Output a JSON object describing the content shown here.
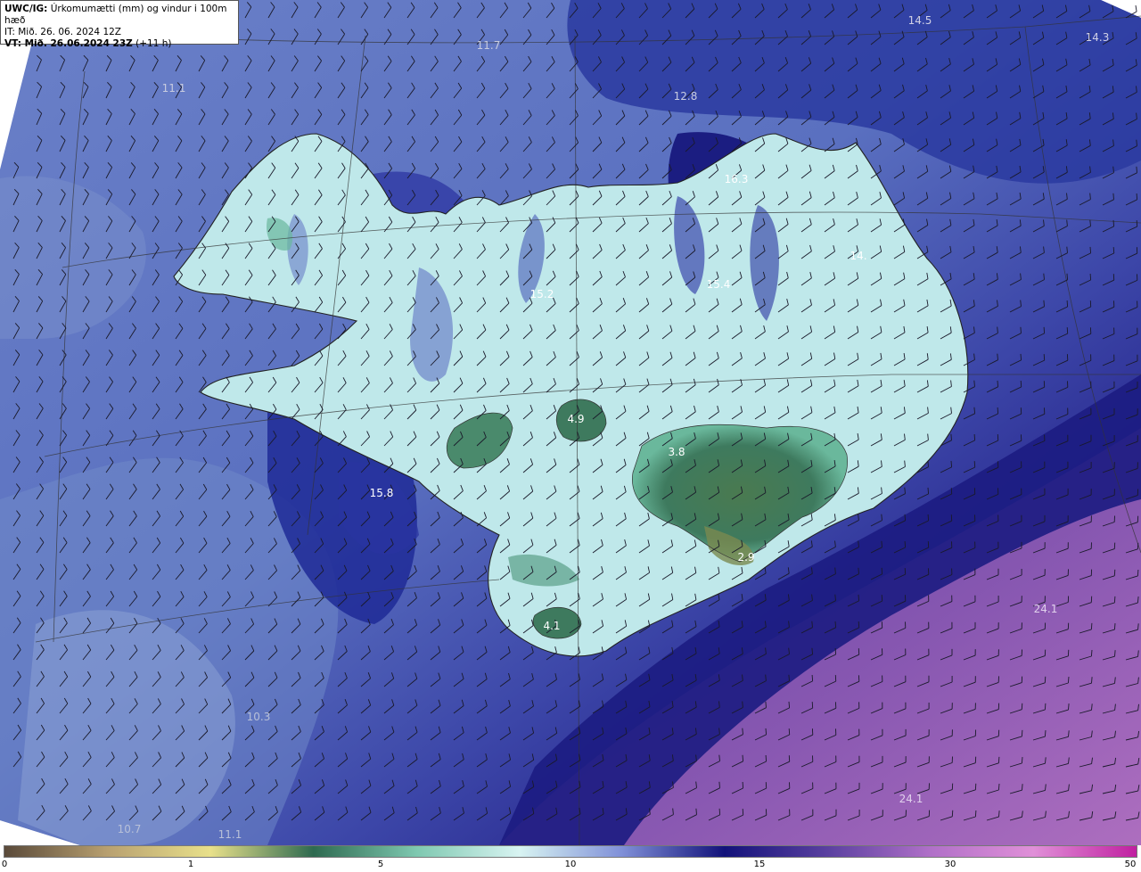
{
  "info_box": {
    "title_bold": "UWC/IG:",
    "title_rest": "Úrkomumætti (mm) og vindur i 100m hæð",
    "line_it": "IT: Mið. 26. 06. 2024 12Z",
    "line_vt_bold": "VT: Mið. 26.06.2024 23Z",
    "line_vt_rest": "(+11 h)"
  },
  "value_labels": [
    {
      "id": "v1",
      "text": "14.5",
      "color": "#d0d0e6"
    },
    {
      "id": "v2",
      "text": "14.3",
      "color": "#d0d0e6"
    },
    {
      "id": "v3",
      "text": "11.7",
      "color": "#c8cce0"
    },
    {
      "id": "v4",
      "text": "11.1",
      "color": "#c8cce0"
    },
    {
      "id": "v5",
      "text": "12.8",
      "color": "#c8cce0"
    },
    {
      "id": "v6",
      "text": "16.3",
      "color": "#ffffff"
    },
    {
      "id": "v7",
      "text": "14.",
      "color": "#ffffff"
    },
    {
      "id": "v8",
      "text": "15.4",
      "color": "#ffffff"
    },
    {
      "id": "v9",
      "text": "15.2",
      "color": "#ffffff"
    },
    {
      "id": "v10",
      "text": "4.9",
      "color": "#ffffff"
    },
    {
      "id": "v11",
      "text": "3.8",
      "color": "#ffffff"
    },
    {
      "id": "v12",
      "text": "15.8",
      "color": "#ffffff"
    },
    {
      "id": "v13",
      "text": "2.9",
      "color": "#ffffff"
    },
    {
      "id": "v14",
      "text": "4.1",
      "color": "#ffffff"
    },
    {
      "id": "v15",
      "text": "24.1",
      "color": "#e0d0ec"
    },
    {
      "id": "v16",
      "text": "24.1",
      "color": "#e0d0ec"
    },
    {
      "id": "v17",
      "text": "10.3",
      "color": "#b8c0d8"
    },
    {
      "id": "v18",
      "text": "10.7",
      "color": "#b8c0d8"
    },
    {
      "id": "v19",
      "text": "11.1",
      "color": "#b8c0d8"
    }
  ],
  "colorbar": {
    "ticks": [
      "0",
      "1",
      "5",
      "10",
      "15",
      "30",
      "50"
    ],
    "stops": [
      "#5a4a3a",
      "#b8a070",
      "#e8e08a",
      "#2e6a50",
      "#7ec8b0",
      "#d8f4f2",
      "#8090d8",
      "#12127a",
      "#5a40a0",
      "#b070c8",
      "#e090d8",
      "#c020a0"
    ]
  },
  "colors": {
    "ocean_base": "#5c74c0",
    "land_green": "#3e7a5e",
    "land_cyan": "#c6ecee",
    "deep_blue": "#1a1a80",
    "purple": "#9060b0"
  }
}
